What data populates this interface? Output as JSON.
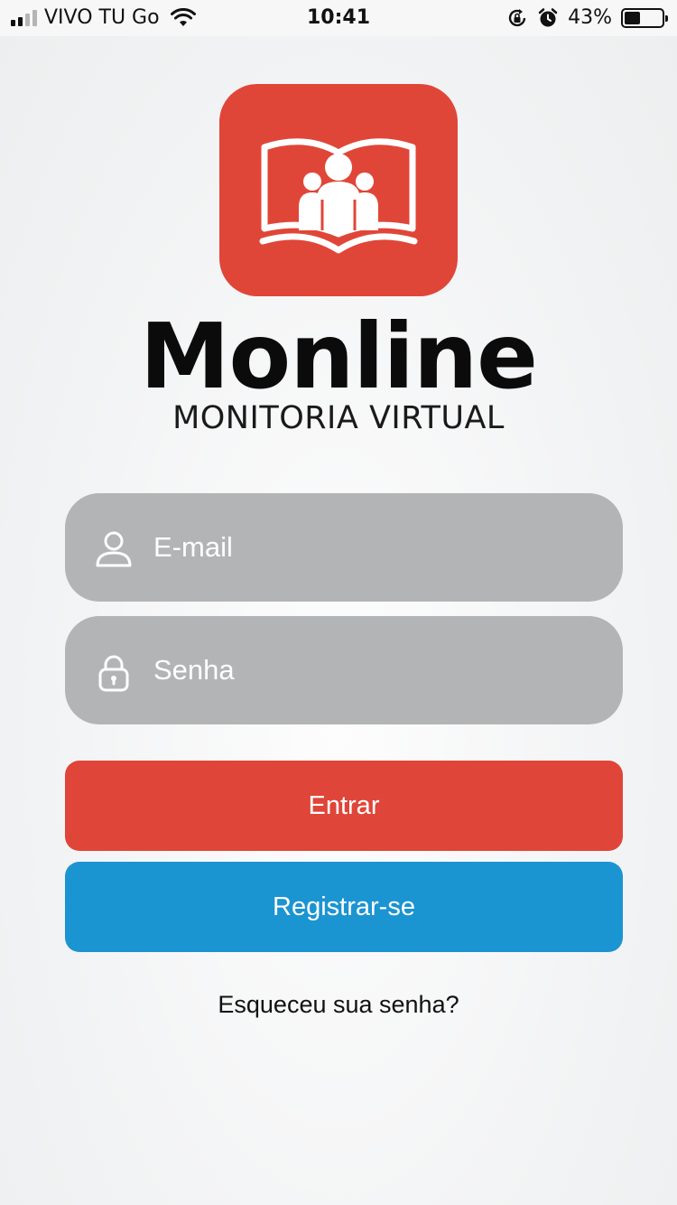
{
  "status_bar": {
    "carrier": "VIVO TU Go",
    "time": "10:41",
    "battery_percent": "43%",
    "battery_level": 0.43,
    "icons": [
      "signal-icon",
      "wifi-icon",
      "rotation-lock-icon",
      "alarm-icon",
      "battery-icon"
    ]
  },
  "brand": {
    "name": "Monline",
    "tagline": "MONITORIA VIRTUAL",
    "logo_icon": "book-with-people-icon",
    "accent_color": "#e04638"
  },
  "form": {
    "email": {
      "placeholder": "E-mail",
      "value": "",
      "icon": "user-icon"
    },
    "password": {
      "placeholder": "Senha",
      "value": "",
      "icon": "lock-icon"
    },
    "field_color": "#b3b4b5"
  },
  "buttons": {
    "login_label": "Entrar",
    "login_color": "#df4538",
    "register_label": "Registrar-se",
    "register_color": "#1b94d2"
  },
  "forgot_password_label": "Esqueceu sua senha?"
}
